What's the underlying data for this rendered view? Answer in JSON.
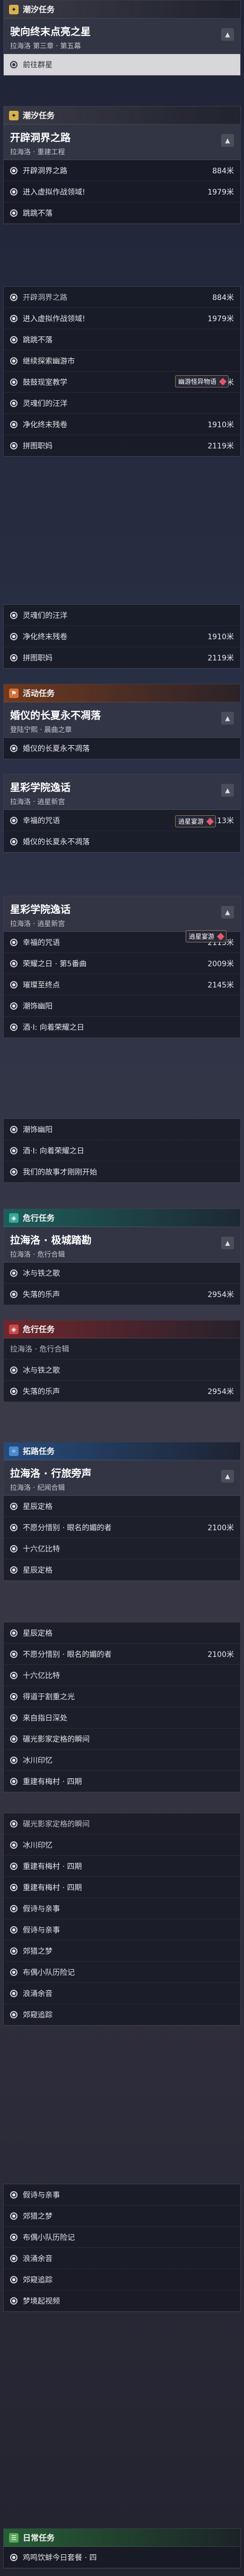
{
  "sec1": {
    "label": "潮汐任务"
  },
  "q1": {
    "title": "驶向终末点亮之星",
    "sub": "拉海洛 第三章 · 第五幕"
  },
  "q1_obj": {
    "label": "前往群星"
  },
  "sec2": {
    "label": "潮汐任务"
  },
  "q2": {
    "title": "开辟洞界之路",
    "sub": "拉海洛 · 重建工程"
  },
  "q2_rows": [
    {
      "label": "开辟洞界之路",
      "dist": "884米"
    },
    {
      "label": "进入虚拟作战领域!",
      "dist": "1979米"
    },
    {
      "label": "跳跳不落",
      "dist": ""
    }
  ],
  "q2b_rows": [
    {
      "label": "开辟洞界之路",
      "dist": "884米"
    },
    {
      "label": "进入虚拟作战领域!",
      "dist": "1979米"
    },
    {
      "label": "跳跳不落",
      "dist": ""
    },
    {
      "label": "继续探索幽游市",
      "dist": ""
    },
    {
      "label": "鼓鼓现室教学",
      "dist": "2721米"
    },
    {
      "label": "灵魂们的汪洋",
      "dist": ""
    },
    {
      "label": "净化终末残卷",
      "dist": "1910米"
    },
    {
      "label": "拼图职妈",
      "dist": "2119米"
    }
  ],
  "badge1": {
    "label": "幽游怪异物语"
  },
  "q2c_rows": [
    {
      "label": "灵魂们的汪洋",
      "dist": ""
    },
    {
      "label": "净化终末残卷",
      "dist": "1910米"
    },
    {
      "label": "拼图职妈",
      "dist": "2119米"
    }
  ],
  "sec3": {
    "label": "活动任务"
  },
  "q3": {
    "title": "婚仪的长夏永不凋落",
    "sub": "登陆宁熙 · 晨曲之章"
  },
  "q3_obj": {
    "label": "婚仪的长夏永不凋落"
  },
  "q4": {
    "title": "星彩学院逸话",
    "sub": "拉海洛 · 逍星新宫"
  },
  "badge2": {
    "label": "逍星宴游"
  },
  "q4_rows": [
    {
      "label": "幸福的咒语",
      "dist": "2113米"
    }
  ],
  "q4b_rows": [
    {
      "label": "婚仪的长夏永不凋落",
      "dist": ""
    }
  ],
  "q5": {
    "title": "星彩学院逸话",
    "sub": "拉海洛 · 逍星新宫"
  },
  "badge3": {
    "label": "逍星宴游"
  },
  "q5_rows": [
    {
      "label": "幸福的咒语",
      "dist": "2113米"
    },
    {
      "label": "荣耀之日 · 第5番曲",
      "dist": "2009米"
    },
    {
      "label": "璀璨至终点",
      "dist": "2145米"
    },
    {
      "label": "潮饰幽阳",
      "dist": ""
    },
    {
      "label": "酒·Ⅰ: 向着荣耀之日",
      "dist": ""
    }
  ],
  "q5b_rows": [
    {
      "label": "潮饰幽阳",
      "dist": ""
    },
    {
      "label": "酒·Ⅰ: 向着荣耀之日",
      "dist": ""
    },
    {
      "label": "我们的故事才刚刚开始",
      "dist": ""
    }
  ],
  "sec4": {
    "label": "危行任务"
  },
  "q6": {
    "title": "拉海洛 · 极城踏勘",
    "sub": "拉海洛 · 危行合辑"
  },
  "q6_rows": [
    {
      "label": "冰与铁之歌",
      "dist": ""
    },
    {
      "label": "失落的乐声",
      "dist": "2954米"
    }
  ],
  "sec5": {
    "label": "危行任务"
  },
  "q6b": {
    "sub": "拉海洛 · 危行合辑"
  },
  "q6b_rows": [
    {
      "label": "冰与铁之歌",
      "dist": ""
    },
    {
      "label": "失落的乐声",
      "dist": "2954米"
    }
  ],
  "sec6": {
    "label": "拓路任务"
  },
  "q7": {
    "title": "拉海洛 · 行旅旁声",
    "sub": "拉海洛 · 纪闻合辑"
  },
  "q7_rows": [
    {
      "label": "星辰定格",
      "dist": ""
    },
    {
      "label": "不愿分惜别 · 眼名的媚的者",
      "dist": "2100米"
    },
    {
      "label": "十六亿比特",
      "dist": ""
    },
    {
      "label": "星辰定格",
      "dist": ""
    }
  ],
  "q7b_rows": [
    {
      "label": "星辰定格",
      "dist": ""
    },
    {
      "label": "不愿分惜别 · 眼名的媚的者",
      "dist": "2100米"
    },
    {
      "label": "十六亿比特",
      "dist": ""
    },
    {
      "label": "得道于割重之光",
      "dist": ""
    },
    {
      "label": "来自指日深处",
      "dist": ""
    },
    {
      "label": "碾光影家定格的瞬间",
      "dist": ""
    },
    {
      "label": "冰川印忆",
      "dist": ""
    },
    {
      "label": "重建有梅村 · 四期",
      "dist": ""
    }
  ],
  "q7c_rows": [
    {
      "label": "碾光影家定格的瞬间",
      "dist": ""
    },
    {
      "label": "冰川印忆",
      "dist": ""
    },
    {
      "label": "重建有梅村 · 四期",
      "dist": ""
    },
    {
      "label": "重建有梅村 · 四期",
      "dist": ""
    },
    {
      "label": "假诗与亲事",
      "dist": ""
    },
    {
      "label": "假诗与亲事",
      "dist": ""
    },
    {
      "label": "郊猎之梦",
      "dist": ""
    },
    {
      "label": "布偶小队历险记",
      "dist": ""
    },
    {
      "label": "浪涌余音",
      "dist": ""
    },
    {
      "label": "郊窥追踪",
      "dist": ""
    }
  ],
  "q7d_rows": [
    {
      "label": "假诗与亲事",
      "dist": ""
    },
    {
      "label": "郊猎之梦",
      "dist": ""
    },
    {
      "label": "布偶小队历险记",
      "dist": ""
    },
    {
      "label": "浪涌余音",
      "dist": ""
    },
    {
      "label": "郊窥追踪",
      "dist": ""
    },
    {
      "label": "梦境起视频",
      "dist": ""
    }
  ],
  "sec7": {
    "label": "日常任务"
  },
  "q8_rows": [
    {
      "label": "鸡鸣饮蚌今日套餐 · 四",
      "dist": ""
    }
  ]
}
